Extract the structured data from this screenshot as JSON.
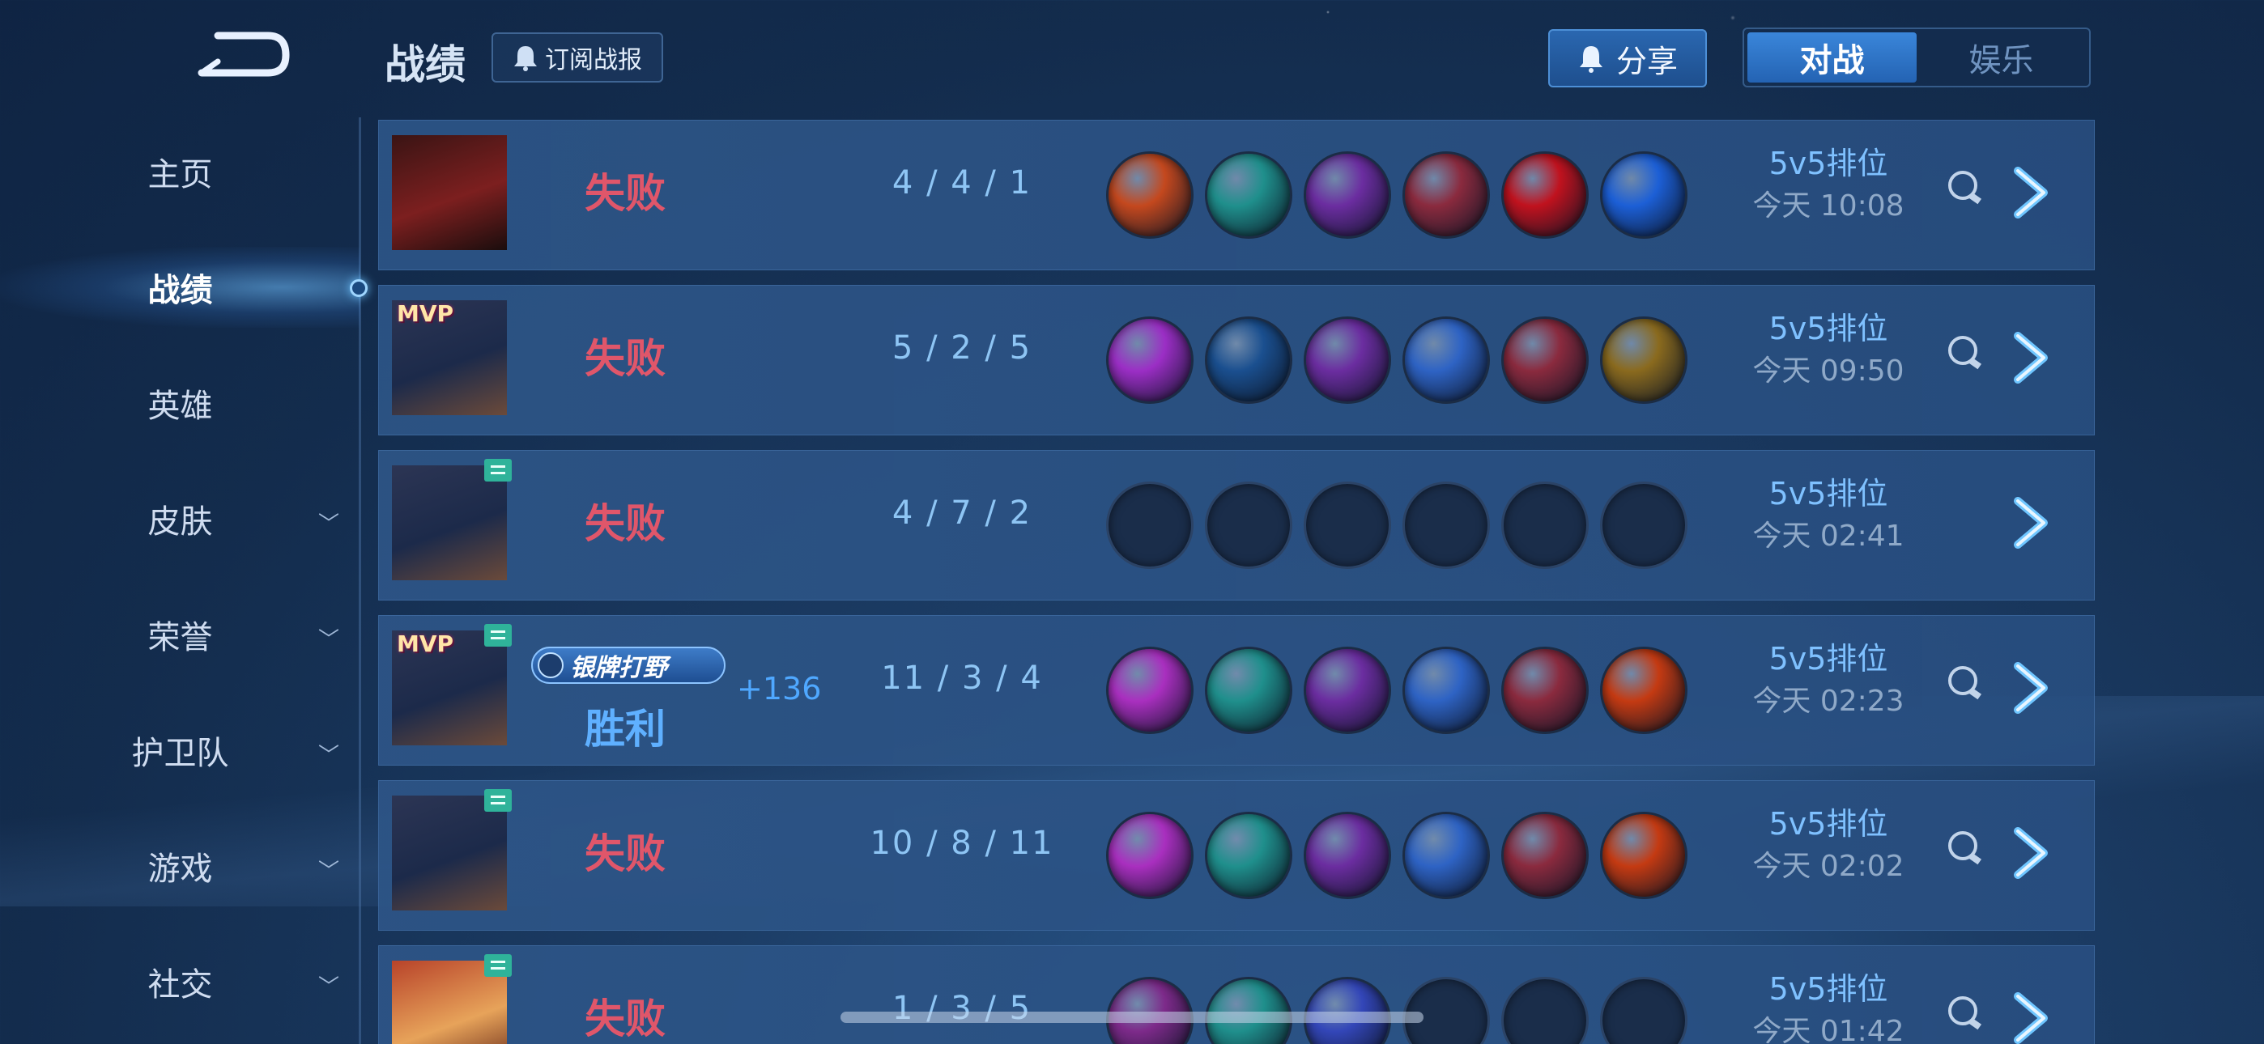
{
  "header": {
    "title": "战绩",
    "subscribe_label": "订阅战报",
    "share_label": "分享",
    "tabs": [
      {
        "label": "对战",
        "active": true
      },
      {
        "label": "娱乐",
        "active": false
      }
    ]
  },
  "sidebar": {
    "items": [
      {
        "label": "主页",
        "has_chevron": false,
        "active": false
      },
      {
        "label": "战绩",
        "has_chevron": false,
        "active": true
      },
      {
        "label": "英雄",
        "has_chevron": false,
        "active": false
      },
      {
        "label": "皮肤",
        "has_chevron": true,
        "active": false
      },
      {
        "label": "荣誉",
        "has_chevron": true,
        "active": false
      },
      {
        "label": "护卫队",
        "has_chevron": true,
        "active": false
      },
      {
        "label": "游戏",
        "has_chevron": true,
        "active": false
      },
      {
        "label": "社交",
        "has_chevron": true,
        "active": false
      }
    ]
  },
  "matches": [
    {
      "result": "失败",
      "win": false,
      "mvp": false,
      "tag": false,
      "kda": "4 / 4 / 1",
      "mode": "5v5排位",
      "time": "今天 10:08",
      "replay": true,
      "items": [
        "#c4481e",
        "#1f8f8c",
        "#6b2da0",
        "#8a2a3e",
        "#c0121e",
        "#1c5fd6"
      ]
    },
    {
      "result": "失败",
      "win": false,
      "mvp": true,
      "tag": false,
      "kda": "5 / 2 / 5",
      "mode": "5v5排位",
      "time": "今天 09:50",
      "replay": true,
      "items": [
        "#9b2ec5",
        "#1a4f8f",
        "#6b2da0",
        "#2e63c4",
        "#8a2a3e",
        "#8a6a1e"
      ]
    },
    {
      "result": "失败",
      "win": false,
      "mvp": false,
      "tag": true,
      "kda": "4 / 7 / 2",
      "mode": "5v5排位",
      "time": "今天 02:41",
      "replay": false,
      "items": [
        "",
        "",
        "",
        "",
        "",
        ""
      ]
    },
    {
      "result": "胜利",
      "win": true,
      "mvp": true,
      "tag": true,
      "rank_label": "银牌打野",
      "points": "+136",
      "kda": "11 / 3 / 4",
      "mode": "5v5排位",
      "time": "今天 02:23",
      "replay": true,
      "items": [
        "#a92fbf",
        "#1f8f8c",
        "#6b2da0",
        "#2e63c4",
        "#8a2a3e",
        "#c43a12"
      ]
    },
    {
      "result": "失败",
      "win": false,
      "mvp": false,
      "tag": true,
      "kda": "10 / 8 / 11",
      "mode": "5v5排位",
      "time": "今天 02:02",
      "replay": true,
      "items": [
        "#a92fbf",
        "#1f8f8c",
        "#6b2da0",
        "#2e63c4",
        "#8a2a3e",
        "#c43a12"
      ]
    },
    {
      "result": "失败",
      "win": false,
      "mvp": false,
      "tag": true,
      "kda": "1 / 3 / 5",
      "mode": "5v5排位",
      "time": "今天 01:42",
      "replay": true,
      "items": [
        "#7d2a8a",
        "#1f8f8c",
        "#3346b8",
        "",
        "",
        ""
      ]
    }
  ],
  "icons": {
    "back": "back-arrow-icon",
    "bell": "bell-icon",
    "share": "share-icon",
    "replay": "replay-camera-icon",
    "detail": "chevron-right-icon"
  },
  "colors": {
    "lose": "#e0566a",
    "win": "#5fb0ff",
    "accent": "#2a67b0"
  }
}
